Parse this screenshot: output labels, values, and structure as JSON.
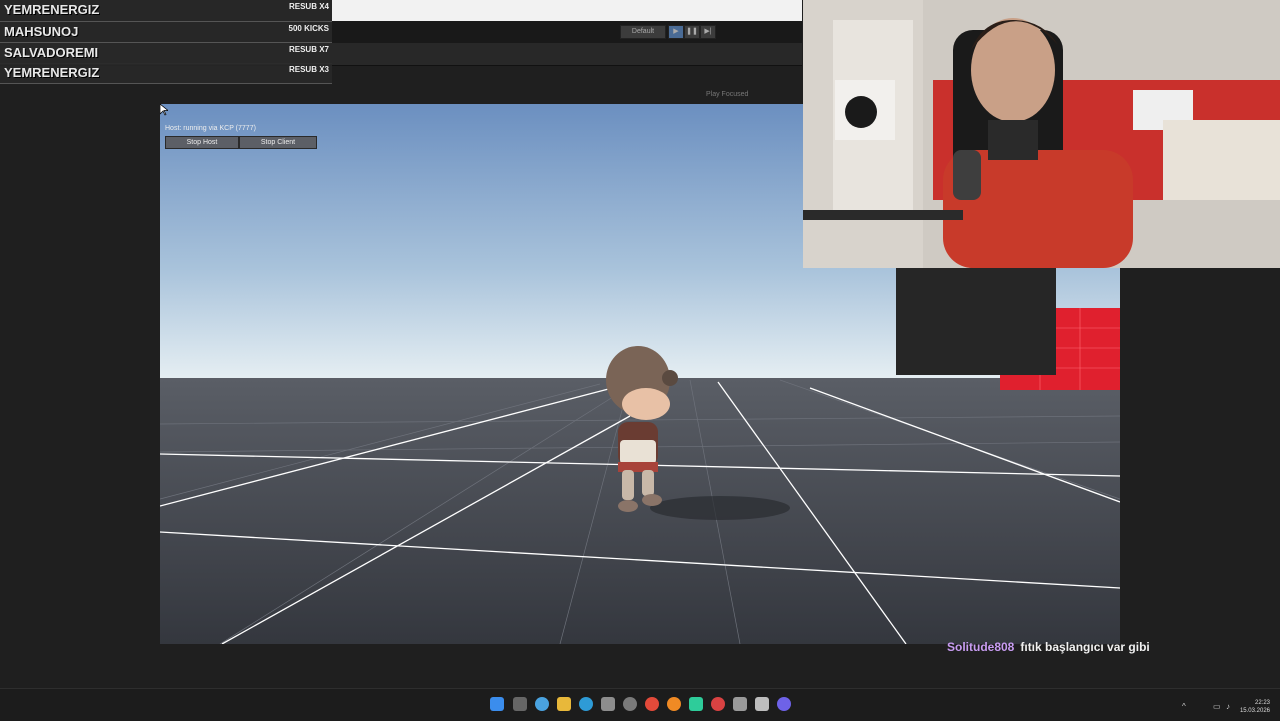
{
  "subscriber_overlay": [
    {
      "name": "YEMRENERGIZ",
      "info": "RESUB X4"
    },
    {
      "name": "MAHSUNOJ",
      "info": "500 KICKS"
    },
    {
      "name": "SALVADOREMI",
      "info": "RESUB X7"
    },
    {
      "name": "YEMRENERGIZ",
      "info": "RESUB X3"
    }
  ],
  "editor": {
    "play_mode_label": "Default",
    "view_label": "Play Focused"
  },
  "game_view": {
    "host_status": "Host: running via KCP (7777)",
    "stop_host_label": "Stop Host",
    "stop_client_label": "Stop Client"
  },
  "chat": {
    "user": "Solitude808",
    "message": "fıtık başlangıcı var gibi",
    "user_color": "#c89cf2"
  },
  "taskbar": {
    "time": "22:23",
    "date": "15.03.2026",
    "icons": [
      "windows-start-icon",
      "task-view-icon",
      "copilot-icon",
      "file-explorer-icon",
      "edge-icon",
      "store-icon",
      "settings-icon",
      "chrome-icon",
      "firefox-icon",
      "app-icon",
      "chrome-dev-icon",
      "unity-hub-icon",
      "unity-icon",
      "discord-icon"
    ]
  },
  "colors": {
    "sky_top": "#6b8fc0",
    "sky_bottom": "#dfe9f0",
    "ground": "#3a3d44",
    "red_wall": "#e0202e"
  }
}
